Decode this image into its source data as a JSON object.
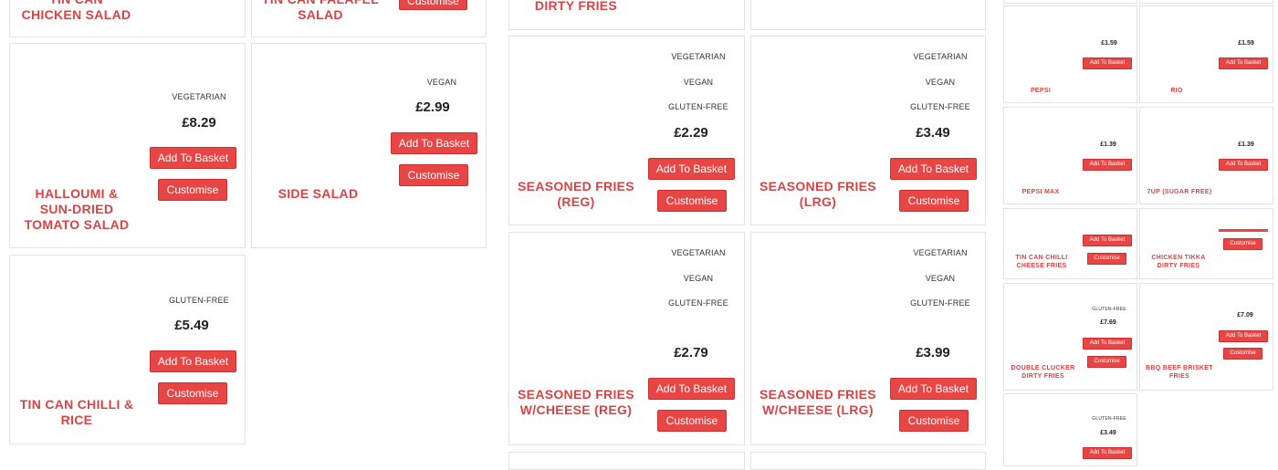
{
  "labels": {
    "add": "Add To Basket",
    "customise": "Customise"
  },
  "products": {
    "tin_can_chicken_salad": {
      "name": "TIN CAN CHICKEN SALAD"
    },
    "tin_can_falafel_salad": {
      "name": "TIN CAN FALAFEL SALAD"
    },
    "dirty_fries_top": {
      "name": "DIRTY FRIES"
    },
    "halloumi": {
      "name": "HALLOUMI & SUN-DRIED TOMATO SALAD",
      "tags": [
        "VEGETARIAN"
      ],
      "price": "£8.29"
    },
    "side_salad": {
      "name": "SIDE SALAD",
      "tags": [
        "VEGAN"
      ],
      "price": "£2.99"
    },
    "tin_can_chilli_rice": {
      "name": "TIN CAN CHILLI & RICE",
      "tags": [
        "GLUTEN-FREE"
      ],
      "price": "£5.49"
    },
    "seasoned_fries_reg": {
      "name": "SEASONED FRIES (REG)",
      "tags": [
        "VEGETARIAN",
        "VEGAN",
        "GLUTEN-FREE"
      ],
      "price": "£2.29"
    },
    "seasoned_fries_lrg": {
      "name": "SEASONED FRIES (LRG)",
      "tags": [
        "VEGETARIAN",
        "VEGAN",
        "GLUTEN-FREE"
      ],
      "price": "£3.49"
    },
    "seasoned_fries_cheese_reg": {
      "name": "SEASONED FRIES W/CHEESE (REG)",
      "tags": [
        "VEGETARIAN",
        "VEGAN",
        "GLUTEN-FREE"
      ],
      "price": "£2.79"
    },
    "seasoned_fries_cheese_lrg": {
      "name": "SEASONED FRIES W/CHEESE (LRG)",
      "tags": [
        "VEGETARIAN",
        "VEGAN",
        "GLUTEN-FREE"
      ],
      "price": "£3.99"
    },
    "pepsi": {
      "name": "PEPSI",
      "price": "£1.59"
    },
    "rio": {
      "name": "RIO",
      "price": "£1.59"
    },
    "pepsi_max": {
      "name": "PEPSI MAX",
      "price": "£1.39"
    },
    "7up_free": {
      "name": "7UP (SUGAR FREE)",
      "price": "£1.39"
    },
    "tin_can_chilli_cheese_fries": {
      "name": "TIN CAN CHILLI CHEESE FRIES"
    },
    "chicken_tikka_dirty_fries": {
      "name": "CHICKEN TIKKA DIRTY FRIES"
    },
    "double_clucker": {
      "name": "DOUBLE CLUCKER DIRTY FRIES",
      "tags": [
        "GLUTEN-FREE"
      ],
      "price": "£7.69"
    },
    "bbq_beef_brisket": {
      "name": "BBQ BEEF BRISKET FRIES",
      "price": "£7.09"
    },
    "bottom_small": {
      "tags": [
        "GLUTEN-FREE"
      ],
      "price": "£3.49"
    }
  },
  "colors": {
    "accent": "#e84545",
    "name_red": "#d64545",
    "border": "#e2e2e2"
  }
}
